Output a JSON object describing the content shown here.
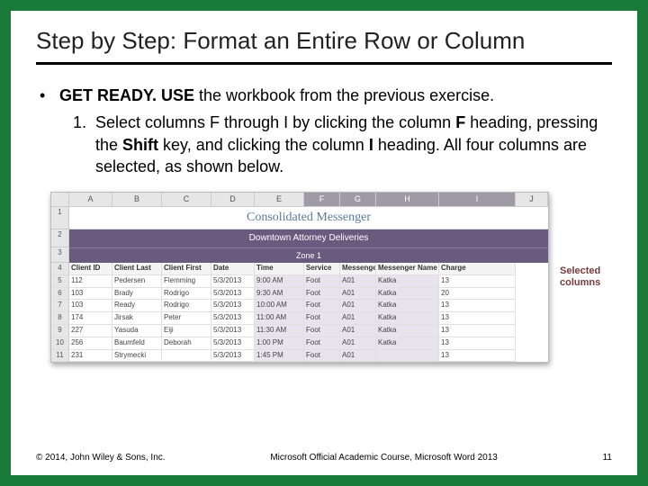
{
  "title": "Step by Step: Format an Entire Row or Column",
  "bullet": {
    "lead": "GET READY. USE",
    "rest": " the workbook from the previous exercise."
  },
  "step1": {
    "num": "1.",
    "p1": "Select columns F through I by clicking the column ",
    "b1": "F",
    "p2": " heading, pressing the ",
    "b2": "Shift",
    "p3": " key, and clicking the column ",
    "b3": "I",
    "p4": " heading. All four columns are selected, as shown below."
  },
  "callout": "Selected columns",
  "sheet": {
    "cols": [
      "",
      "A",
      "B",
      "C",
      "D",
      "E",
      "F",
      "G",
      "H",
      "I",
      "J"
    ],
    "title": "Consolidated Messenger",
    "sub": "Downtown Attorney Deliveries",
    "zone": "Zone 1",
    "headers": [
      "Client ID",
      "Client Last",
      "Client First",
      "Date",
      "Time",
      "Service",
      "Messenger ID",
      "Messenger Name",
      "Charge"
    ],
    "rows": [
      {
        "n": "5",
        "d": [
          "112",
          "Pedersen",
          "Flemming",
          "5/3/2013",
          "9:00 AM",
          "Foot",
          "A01",
          "Katka",
          "13"
        ]
      },
      {
        "n": "6",
        "d": [
          "103",
          "Brady",
          "Rodrigo",
          "5/3/2013",
          "9:30 AM",
          "Foot",
          "A01",
          "Katka",
          "20"
        ]
      },
      {
        "n": "7",
        "d": [
          "103",
          "Ready",
          "Rodrigo",
          "5/3/2013",
          "10:00 AM",
          "Foot",
          "A01",
          "Katka",
          "13"
        ]
      },
      {
        "n": "8",
        "d": [
          "174",
          "Jirsak",
          "Peter",
          "5/3/2013",
          "11:00 AM",
          "Foot",
          "A01",
          "Katka",
          "13"
        ]
      },
      {
        "n": "9",
        "d": [
          "227",
          "Yasuda",
          "Eiji",
          "5/3/2013",
          "11:30 AM",
          "Foot",
          "A01",
          "Katka",
          "13"
        ]
      },
      {
        "n": "10",
        "d": [
          "256",
          "Baumfeld",
          "Deborah",
          "5/3/2013",
          "1:00 PM",
          "Foot",
          "A01",
          "Katka",
          "13"
        ]
      },
      {
        "n": "11",
        "d": [
          "231",
          "Strymecki",
          "",
          "5/3/2013",
          "1:45 PM",
          "Foot",
          "A01",
          "",
          "13"
        ]
      }
    ]
  },
  "footer": {
    "left": "© 2014, John Wiley & Sons, Inc.",
    "mid": "Microsoft Official Academic Course, Microsoft Word 2013",
    "right": "11"
  }
}
